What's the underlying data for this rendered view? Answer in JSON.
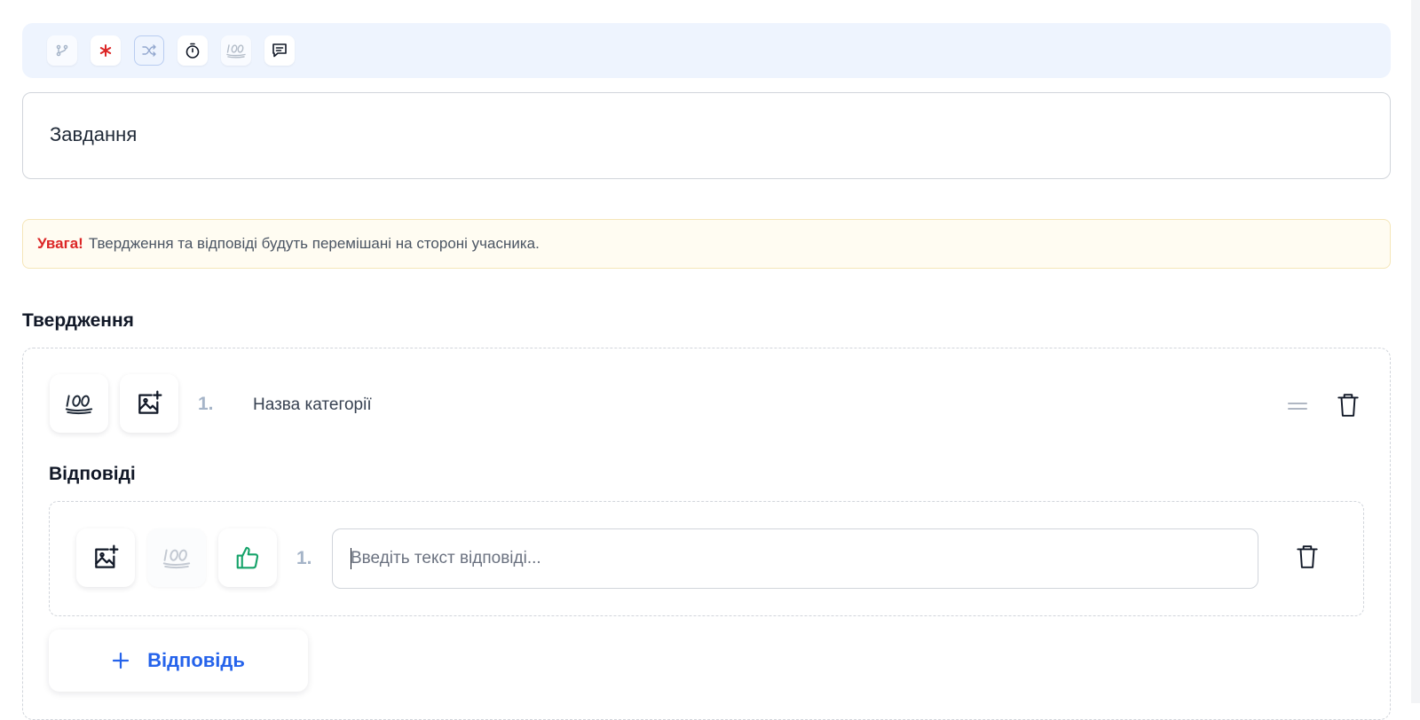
{
  "toolbar": {
    "icons": [
      "branch-icon",
      "asterisk-icon",
      "shuffle-icon",
      "timer-icon",
      "hundred-points-icon",
      "comment-icon"
    ],
    "colors": {
      "asterisk": "#dc2626",
      "selected_border": "#b9cdf1",
      "background": "#eef4fe"
    }
  },
  "task": {
    "title": "Завдання"
  },
  "notice": {
    "label": "Увага!",
    "text": "Твердження та відповіді будуть перемішані на стороні учасника."
  },
  "statements": {
    "title": "Твердження",
    "items": [
      {
        "number": "1.",
        "category": "Назва категорії",
        "answers_title": "Відповіді",
        "answers": [
          {
            "number": "1.",
            "placeholder": "Введіть текст відповіді...",
            "value": ""
          }
        ],
        "add_answer_label": "Відповідь"
      }
    ]
  },
  "colors": {
    "accent": "#2563eb",
    "correct": "#16a36a",
    "warning_bg": "#fffcf2",
    "number": "#a5b4c8"
  }
}
